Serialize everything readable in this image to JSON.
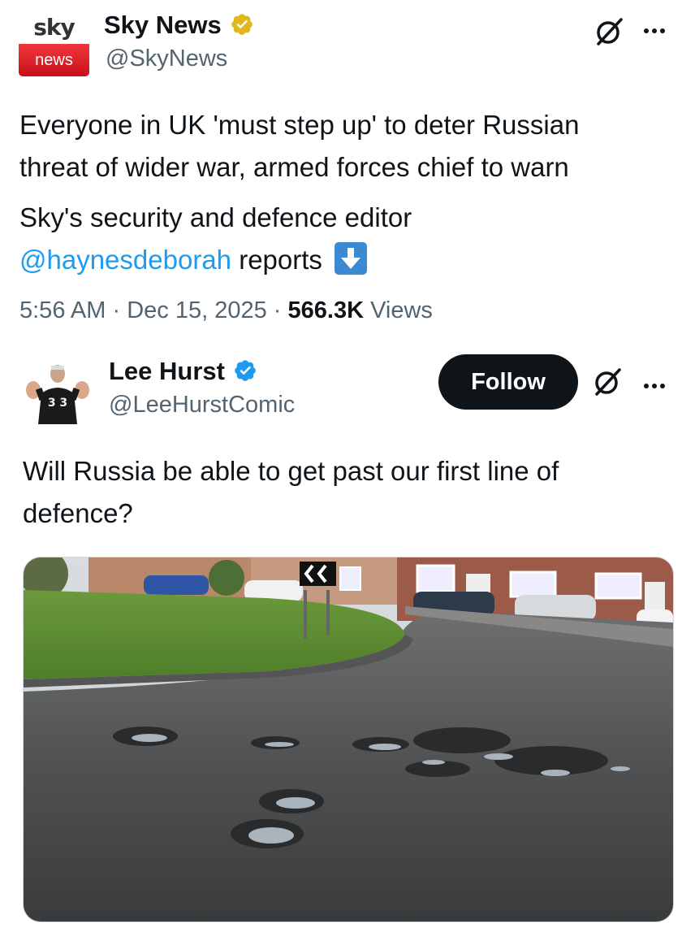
{
  "post1": {
    "logo_top": "sky",
    "logo_bottom": "news",
    "author_name": "Sky News",
    "author_handle": "@SkyNews",
    "verified": "gold",
    "text_line1": "Everyone in UK 'must step up' to deter Russian",
    "text_line2": "threat of wider war, armed forces chief to warn",
    "text_line3": "Sky's security and defence editor",
    "mention": "@haynesdeborah",
    "text_after_mention": "reports",
    "time": "5:56 AM",
    "sep1": "·",
    "date": "Dec 15, 2025",
    "sep2": "·",
    "views_count": "566.3K",
    "views_label": "Views"
  },
  "post2": {
    "author_name": "Lee Hurst",
    "author_handle": "@LeeHurstComic",
    "verified": "blue",
    "follow_label": "Follow",
    "text_line1": "Will Russia be able to get past our first line of",
    "text_line2": "defence?",
    "avatar_lettering": "3 3"
  },
  "colors": {
    "link": "#1d9bf0",
    "verified_blue": "#1d9bf0",
    "verified_gold": "#e2b719",
    "secondary_text": "#536471",
    "follow_bg": "#0f1419"
  },
  "icons": [
    "grok-icon",
    "more-options-icon",
    "down-arrow-emoji",
    "verified-badge-icon"
  ]
}
